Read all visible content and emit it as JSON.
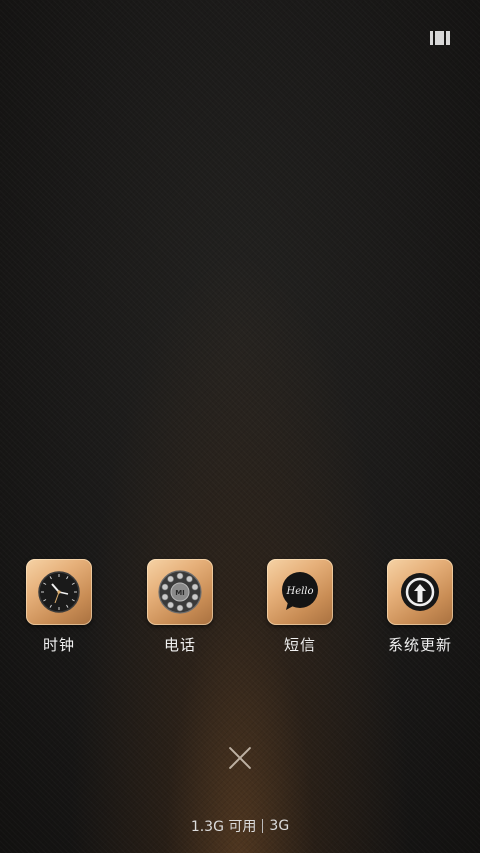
{
  "top_bar": {
    "icon": "recent-apps-icon"
  },
  "apps": [
    {
      "label": "时钟",
      "icon": "clock-icon"
    },
    {
      "label": "电话",
      "icon": "phone-dial-icon",
      "badge_text": "MI"
    },
    {
      "label": "短信",
      "icon": "message-bubble-icon",
      "badge_text": "Hello"
    },
    {
      "label": "系统更新",
      "icon": "system-update-icon"
    }
  ],
  "close": {
    "icon": "close-icon"
  },
  "memory": {
    "available": "1.3G 可用",
    "network": "3G"
  },
  "colors": {
    "tile_gold": "#e6b07a",
    "background_dark": "#1b1a19",
    "label_text": "#f0f0f0"
  }
}
